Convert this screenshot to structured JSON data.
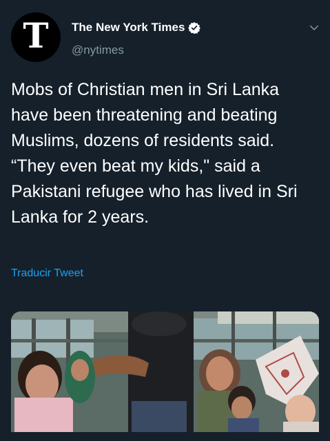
{
  "account": {
    "display_name": "The New York Times",
    "handle": "@nytimes",
    "avatar_glyph": "T"
  },
  "icons": {
    "verified": "verified-badge-icon",
    "more": "chevron-down-icon"
  },
  "tweet": {
    "text": "Mobs of Christian men in Sri Lanka have been threatening and beating Muslims, dozens of residents said. “They even beat my kids,\" said a Pakistani refugee who has lived in Sri Lanka for 2 years.",
    "translate_label": "Traducir Tweet"
  },
  "colors": {
    "background": "#15202b",
    "link": "#1da1f2",
    "secondary_text": "#8899a6"
  }
}
